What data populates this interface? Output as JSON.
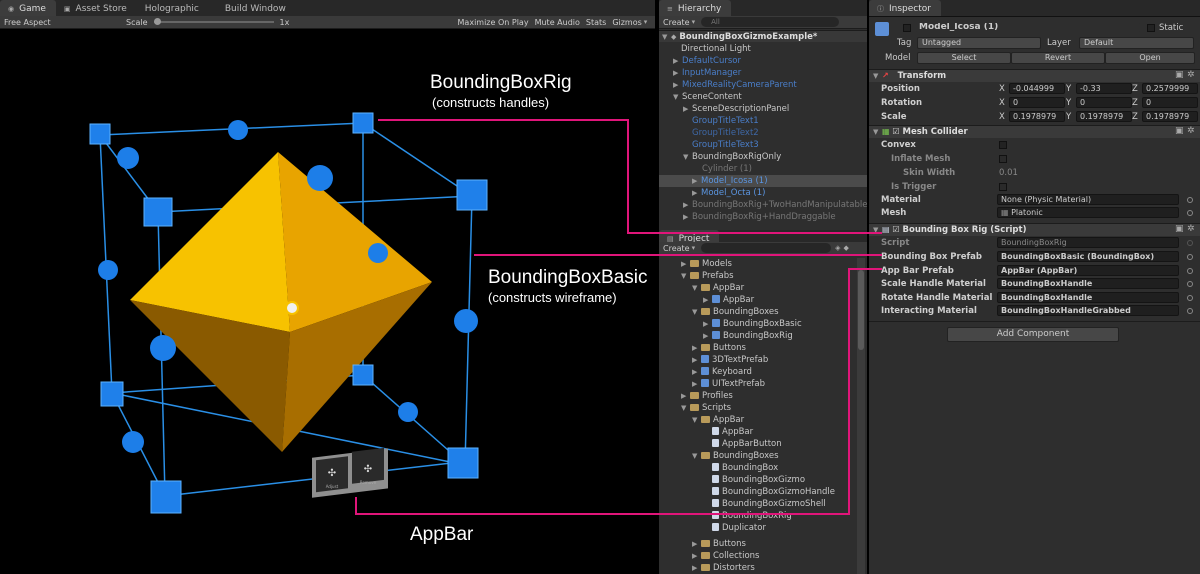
{
  "game_tabs": {
    "game": "Game",
    "asset_store": "Asset Store",
    "holographic": "Holographic",
    "build_window": "Build Window"
  },
  "game_toolbar": {
    "aspect": "Free Aspect",
    "scale_label": "Scale",
    "scale_value": "1x",
    "maximize": "Maximize On Play",
    "mute": "Mute Audio",
    "stats": "Stats",
    "gizmos": "Gizmos"
  },
  "callouts": {
    "rig_title": "BoundingBoxRig",
    "rig_sub": "(constructs handles)",
    "basic_title": "BoundingBoxBasic",
    "basic_sub": "(constructs wireframe)",
    "appbar_title": "AppBar"
  },
  "appbar_buttons": [
    "Adjust",
    "Remove"
  ],
  "colors": {
    "callout_line": "#e0157a",
    "handle": "#1e7fe6",
    "pyramid": "#f5b800"
  },
  "hierarchy": {
    "tab": "Hierarchy",
    "create": "Create",
    "search_placeholder": "All",
    "scene": "BoundingBoxGizmoExample*",
    "items": [
      "Directional Light",
      "DefaultCursor",
      "InputManager",
      "MixedRealityCameraParent",
      "SceneContent",
      "SceneDescriptionPanel",
      "GroupTitleText1",
      "GroupTitleText2",
      "GroupTitleText3",
      "BoundingBoxRigOnly",
      "Cylinder (1)",
      "Model_Icosa (1)",
      "Model_Octa (1)",
      "BoundingBoxRig+TwoHandManipulatable",
      "BoundingBoxRig+HandDraggable"
    ]
  },
  "project": {
    "tab": "Project",
    "create": "Create",
    "items": [
      "Models",
      "Prefabs",
      "AppBar",
      "AppBar",
      "BoundingBoxes",
      "BoundingBoxBasic",
      "BoundingBoxRig",
      "Buttons",
      "3DTextPrefab",
      "Keyboard",
      "UITextPrefab",
      "Profiles",
      "Scripts",
      "AppBar",
      "AppBar",
      "AppBarButton",
      "BoundingBoxes",
      "BoundingBox",
      "BoundingBoxGizmo",
      "BoundingBoxGizmoHandle",
      "BoundingBoxGizmoShell",
      "BoundingBoxRig",
      "Duplicator",
      "Buttons",
      "Collections",
      "Distorters"
    ]
  },
  "inspector": {
    "tab": "Inspector",
    "name": "Model_Icosa (1)",
    "static_label": "Static",
    "tag_label": "Tag",
    "tag_value": "Untagged",
    "layer_label": "Layer",
    "layer_value": "Default",
    "model_label": "Model",
    "select": "Select",
    "revert": "Revert",
    "open": "Open",
    "transform": {
      "title": "Transform",
      "position": "Position",
      "rotation": "Rotation",
      "scale": "Scale",
      "px": "-0.044999",
      "py": "-0.33",
      "pz": "0.2579999",
      "rx": "0",
      "ry": "0",
      "rz": "0",
      "sx": "0.1978979",
      "sy": "0.1978979",
      "sz": "0.1978979",
      "x": "X",
      "y": "Y",
      "z": "Z"
    },
    "mesh_collider": {
      "title": "Mesh Collider",
      "convex": "Convex",
      "inflate": "Inflate Mesh",
      "skin": "Skin Width",
      "skin_value": "0.01",
      "trigger": "Is Trigger",
      "material": "Material",
      "material_value": "None (Physic Material)",
      "mesh": "Mesh",
      "mesh_value": "Platonic"
    },
    "bbr": {
      "title": "Bounding Box Rig (Script)",
      "script": "Script",
      "script_value": "BoundingBoxRig",
      "bbp": "Bounding Box Prefab",
      "bbp_value": "BoundingBoxBasic (BoundingBox)",
      "abp": "App Bar Prefab",
      "abp_value": "AppBar (AppBar)",
      "shm": "Scale Handle Material",
      "shm_value": "BoundingBoxHandle",
      "rhm": "Rotate Handle Material",
      "rhm_value": "BoundingBoxHandle",
      "im": "Interacting Material",
      "im_value": "BoundingBoxHandleGrabbed"
    },
    "add_component": "Add Component"
  }
}
